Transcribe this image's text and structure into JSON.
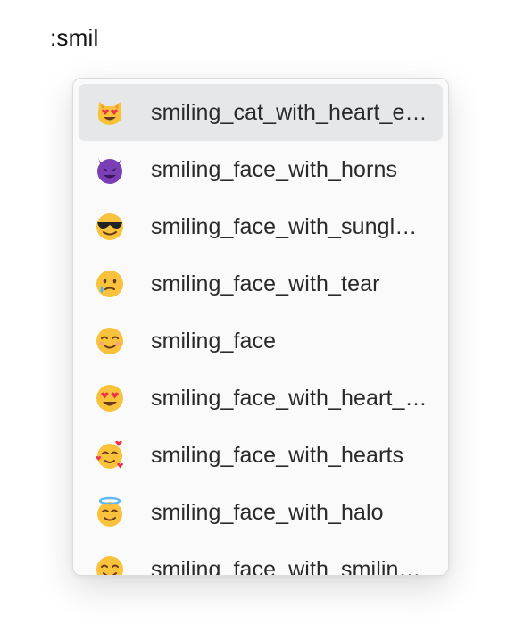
{
  "query": {
    "text": ":smil"
  },
  "suggestions": [
    {
      "label": "smiling_cat_with_heart_eyes",
      "icon": "smiling-cat-heart-eyes-icon",
      "selected": true
    },
    {
      "label": "smiling_face_with_horns",
      "icon": "smiling-face-horns-icon",
      "selected": false
    },
    {
      "label": "smiling_face_with_sunglasses",
      "icon": "smiling-face-sunglasses-icon",
      "selected": false
    },
    {
      "label": "smiling_face_with_tear",
      "icon": "smiling-face-tear-icon",
      "selected": false
    },
    {
      "label": "smiling_face",
      "icon": "smiling-face-icon",
      "selected": false
    },
    {
      "label": "smiling_face_with_heart_eyes",
      "icon": "smiling-face-heart-eyes-icon",
      "selected": false
    },
    {
      "label": "smiling_face_with_hearts",
      "icon": "smiling-face-hearts-icon",
      "selected": false
    },
    {
      "label": "smiling_face_with_halo",
      "icon": "smiling-face-halo-icon",
      "selected": false
    },
    {
      "label": "smiling_face_with_smiling_eyes",
      "icon": "smiling-face-smiling-eyes-icon",
      "selected": false
    }
  ],
  "colors": {
    "selected_background": "#e6e7e9",
    "popup_background": "#fafafa",
    "emoji_yellow": "#f9c23c",
    "devil_purple": "#7b3fb5",
    "heart_red": "#f0314a"
  }
}
